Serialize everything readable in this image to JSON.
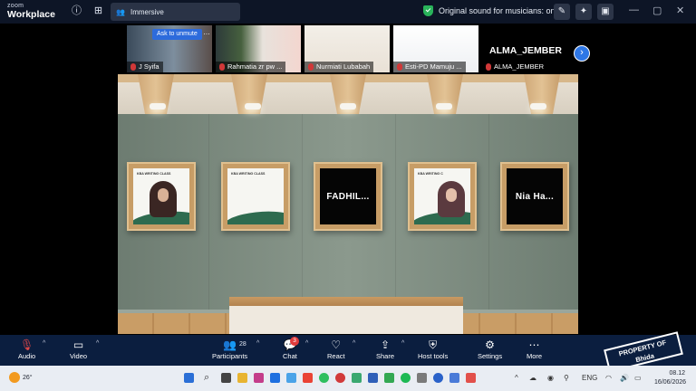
{
  "app": {
    "brand_top": "zoom",
    "brand_bottom": "Workplace"
  },
  "view": {
    "label": "Immersive"
  },
  "sound": {
    "label": "Original sound for musicians: on"
  },
  "strip": {
    "unmute_label": "Ask to unmute",
    "more_label": "…",
    "participants": [
      {
        "name": "J Syifa"
      },
      {
        "name": "Rahmatia zr pw ..."
      },
      {
        "name": "Nurmiati Lubabah"
      },
      {
        "name": "Esti-PD Mamuju ..."
      },
      {
        "name": "ALMA_JEMBER"
      }
    ],
    "big_name": "ALMA_JEMBER"
  },
  "gallery": {
    "frames": [
      {
        "type": "slide-person",
        "caption": "KBA WRITING CLASS"
      },
      {
        "type": "slide",
        "caption": "KBA WRITING CLASS"
      },
      {
        "type": "name",
        "label": "FADHIL..."
      },
      {
        "type": "slide-person",
        "caption": "KBA WRITING C"
      },
      {
        "type": "name",
        "label": "Nia Ha..."
      }
    ]
  },
  "toolbar": {
    "audio": "Audio",
    "video": "Video",
    "participants": "Participants",
    "participants_count": "28",
    "chat": "Chat",
    "chat_badge": "3",
    "react": "React",
    "share": "Share",
    "host_tools": "Host tools",
    "settings": "Settings",
    "more": "More"
  },
  "watermark": {
    "line1": "PROPERTY OF",
    "line2": "Bhida"
  },
  "taskbar": {
    "temperature": "26°",
    "language": "ENG",
    "time": "08.12",
    "date": "16/06/2026"
  },
  "colors": {
    "toolbar_bg": "#0b1e3f",
    "accent": "#2e77e6",
    "muted": "#d03838"
  }
}
